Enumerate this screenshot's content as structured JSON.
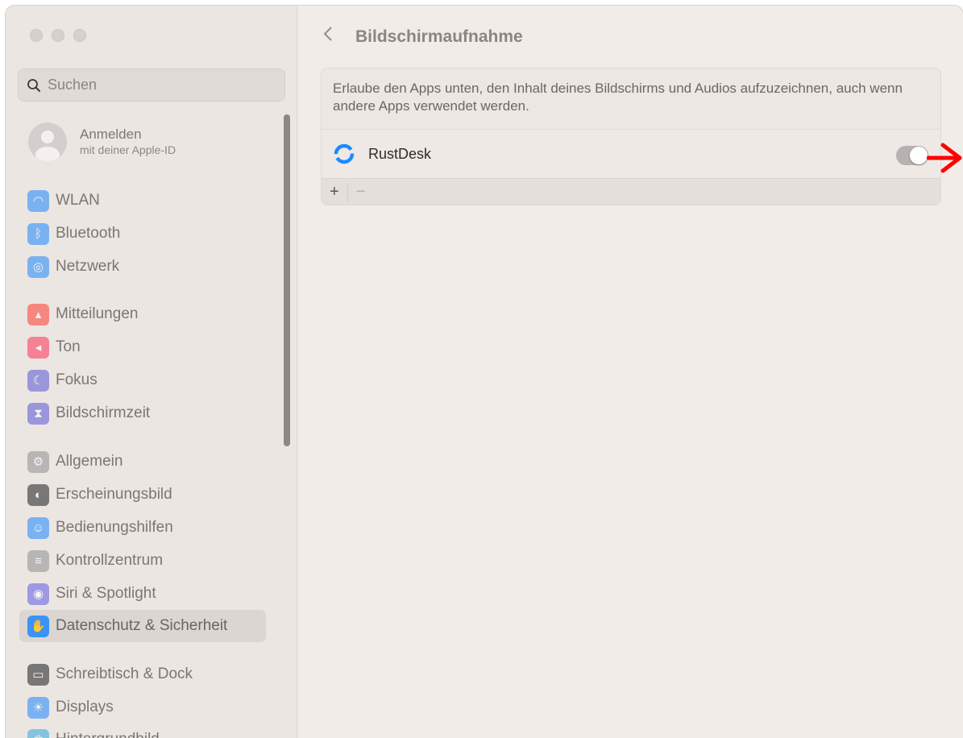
{
  "sidebar": {
    "search_placeholder": "Suchen",
    "account": {
      "name": "Anmelden",
      "subtitle": "mit deiner Apple-ID"
    },
    "items": [
      {
        "label": "WLAN",
        "icon": "wifi-icon",
        "color": "#1e88ff"
      },
      {
        "label": "Bluetooth",
        "icon": "bluetooth-icon",
        "color": "#1e88ff"
      },
      {
        "label": "Netzwerk",
        "icon": "globe-icon",
        "color": "#1e88ff"
      },
      {
        "label": "Mitteilungen",
        "icon": "bell-icon",
        "color": "#ff3b30"
      },
      {
        "label": "Ton",
        "icon": "speaker-icon",
        "color": "#ff2d55"
      },
      {
        "label": "Fokus",
        "icon": "moon-icon",
        "color": "#5856d6"
      },
      {
        "label": "Bildschirmzeit",
        "icon": "hourglass-icon",
        "color": "#5856d6"
      },
      {
        "label": "Allgemein",
        "icon": "gear-icon",
        "color": "#8e8e93"
      },
      {
        "label": "Erscheinungsbild",
        "icon": "appearance-icon",
        "color": "#1c1c1e"
      },
      {
        "label": "Bedienungshilfen",
        "icon": "accessibility-icon",
        "color": "#1e88ff"
      },
      {
        "label": "Kontrollzentrum",
        "icon": "toggles-icon",
        "color": "#8e8e93"
      },
      {
        "label": "Siri & Spotlight",
        "icon": "siri-icon",
        "color": "#5e5ce6"
      },
      {
        "label": "Datenschutz & Sicherheit",
        "icon": "hand-icon",
        "color": "#1e88ff",
        "active": true
      },
      {
        "label": "Schreibtisch & Dock",
        "icon": "dock-icon",
        "color": "#1c1c1e"
      },
      {
        "label": "Displays",
        "icon": "sun-icon",
        "color": "#1e88ff"
      },
      {
        "label": "Hintergrundbild",
        "icon": "flower-icon",
        "color": "#34aadc"
      }
    ]
  },
  "main": {
    "back_icon": "chevron-left-icon",
    "title": "Bildschirmaufnahme",
    "description": "Erlaube den Apps unten, den Inhalt deines Bildschirms und Audios aufzuzeichnen, auch wenn andere Apps verwendet werden.",
    "apps": [
      {
        "name": "RustDesk",
        "icon": "rustdesk-icon",
        "enabled": true
      }
    ],
    "add_label": "+",
    "remove_label": "−",
    "annotation_arrow_color": "#ff0000"
  }
}
